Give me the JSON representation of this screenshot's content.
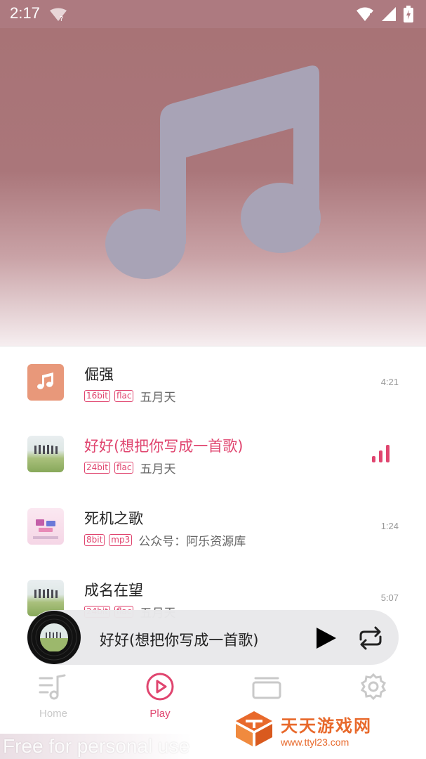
{
  "status_bar": {
    "time": "2:17"
  },
  "songs": [
    {
      "title": "倔强",
      "bit": "16bit",
      "format": "flac",
      "artist": "五月天",
      "duration": "4:21",
      "active": false
    },
    {
      "title": "好好(想把你写成一首歌)",
      "bit": "24bit",
      "format": "flac",
      "artist": "五月天",
      "duration": "",
      "active": true
    },
    {
      "title": "死机之歌",
      "bit": "8bit",
      "format": "mp3",
      "artist": "公众号：阿乐资源库",
      "duration": "1:24",
      "active": false
    },
    {
      "title": "成名在望",
      "bit": "24bit",
      "format": "flac",
      "artist": "五月天",
      "duration": "5:07",
      "active": false
    }
  ],
  "mini_player": {
    "title": "好好(想把你写成一首歌)"
  },
  "nav": {
    "home": "Home",
    "play": "Play"
  },
  "watermark": "Free for personal use",
  "site_logo": {
    "name": "天天游戏网",
    "url": "www.ttyl23.com"
  },
  "colors": {
    "accent": "#e0456f",
    "hero": "#a87376",
    "orange_cover": "#e8987a",
    "logo": "#e8692b"
  },
  "icons": [
    "wifi-question-icon",
    "wifi-icon",
    "signal-icon",
    "battery-icon",
    "music-note-icon",
    "equalizer-icon",
    "play-icon",
    "repeat-icon",
    "home-icon",
    "play-circle-icon",
    "library-icon",
    "settings-icon"
  ]
}
